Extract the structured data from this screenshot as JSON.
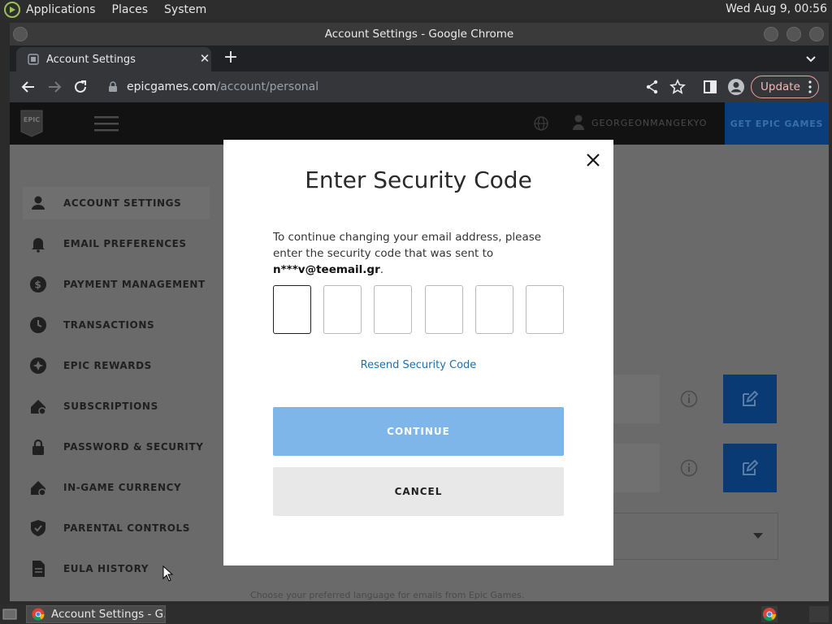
{
  "top_panel": {
    "menus": [
      "Applications",
      "Places",
      "System"
    ],
    "clock": "Wed Aug  9, 00:56"
  },
  "window": {
    "title": "Account Settings - Google Chrome"
  },
  "tab": {
    "title": "Account Settings",
    "close_icon": "close-icon"
  },
  "toolbar": {
    "url_host": "epicgames.com",
    "url_path": "/account/personal",
    "update_label": "Update"
  },
  "epic_header": {
    "username": "GEORGEONMANGEKYO",
    "get_epic": "GET EPIC GAMES"
  },
  "sidebar": {
    "items": [
      {
        "label": "ACCOUNT SETTINGS",
        "icon": "person-icon"
      },
      {
        "label": "EMAIL PREFERENCES",
        "icon": "bell-icon"
      },
      {
        "label": "PAYMENT MANAGEMENT",
        "icon": "dollar-icon"
      },
      {
        "label": "TRANSACTIONS",
        "icon": "clock-icon"
      },
      {
        "label": "EPIC REWARDS",
        "icon": "rewards-icon"
      },
      {
        "label": "SUBSCRIPTIONS",
        "icon": "subscriptions-icon"
      },
      {
        "label": "PASSWORD & SECURITY",
        "icon": "lock-icon"
      },
      {
        "label": "IN-GAME CURRENCY",
        "icon": "currency-icon"
      },
      {
        "label": "PARENTAL CONTROLS",
        "icon": "shield-icon"
      },
      {
        "label": "EULA HISTORY",
        "icon": "document-icon"
      }
    ]
  },
  "page": {
    "lang_hint": "Choose your preferred language for emails from Epic Games."
  },
  "modal": {
    "title": "Enter Security Code",
    "desc_prefix": "To continue changing your email address, please enter the security code that was sent to ",
    "email": "n***v@teemail.gr",
    "desc_suffix": ".",
    "code_values": [
      "",
      "",
      "",
      "",
      "",
      ""
    ],
    "resend": "Resend Security Code",
    "continue": "CONTINUE",
    "cancel": "CANCEL"
  },
  "taskbar": {
    "task_title": "Account Settings - G..."
  },
  "colors": {
    "accent_blue": "#7eb6ea",
    "link_blue": "#1a6fb0",
    "edit_blue": "#0a3a73"
  }
}
